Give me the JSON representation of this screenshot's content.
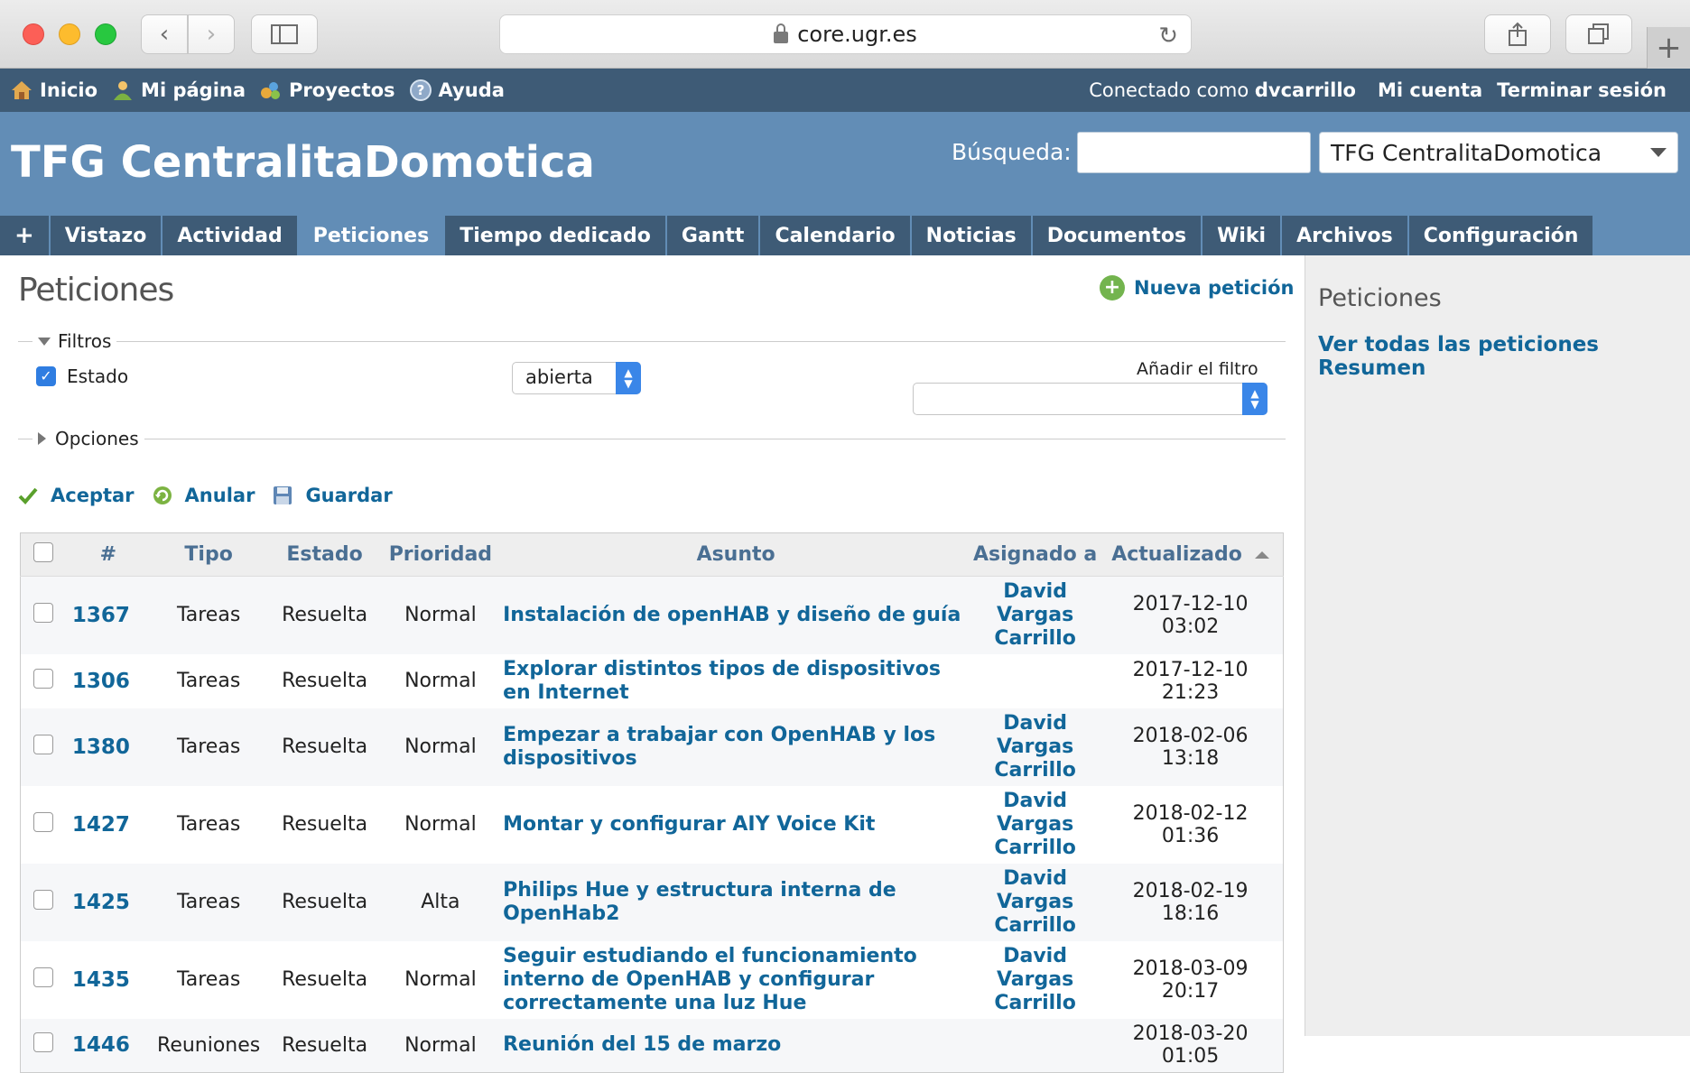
{
  "browser": {
    "url": "core.ugr.es"
  },
  "topmenu": {
    "home": "Inicio",
    "my_page": "Mi página",
    "projects": "Proyectos",
    "help": "Ayuda",
    "logged_prefix": "Conectado como",
    "username": "dvcarrillo",
    "my_account": "Mi cuenta",
    "logout": "Terminar sesión"
  },
  "header": {
    "project_title": "TFG CentralitaDomotica",
    "search_label": "Búsqueda:",
    "search_value": "",
    "project_jump": "TFG CentralitaDomotica"
  },
  "mainmenu": {
    "plus": "+",
    "tabs": [
      "Vistazo",
      "Actividad",
      "Peticiones",
      "Tiempo dedicado",
      "Gantt",
      "Calendario",
      "Noticias",
      "Documentos",
      "Wiki",
      "Archivos",
      "Configuración"
    ],
    "selected": "Peticiones"
  },
  "page": {
    "title": "Peticiones",
    "new_issue": "Nueva petición",
    "filters_legend": "Filtros",
    "filter_status_label": "Estado",
    "filter_status_value": "abierta",
    "add_filter_label": "Añadir el filtro",
    "add_filter_value": "",
    "options_legend": "Opciones",
    "apply": "Aceptar",
    "clear": "Anular",
    "save": "Guardar"
  },
  "table": {
    "columns": [
      "#",
      "Tipo",
      "Estado",
      "Prioridad",
      "Asunto",
      "Asignado a",
      "Actualizado"
    ],
    "rows": [
      {
        "id": "1367",
        "tracker": "Tareas",
        "status": "Resuelta",
        "priority": "Normal",
        "subject": "Instalación de openHAB y diseño de guía",
        "assigned": "David Vargas Carrillo",
        "updated": "2017-12-10 03:02"
      },
      {
        "id": "1306",
        "tracker": "Tareas",
        "status": "Resuelta",
        "priority": "Normal",
        "subject": "Explorar distintos tipos de dispositivos en Internet",
        "assigned": "",
        "updated": "2017-12-10 21:23"
      },
      {
        "id": "1380",
        "tracker": "Tareas",
        "status": "Resuelta",
        "priority": "Normal",
        "subject": "Empezar a trabajar con OpenHAB y los dispositivos",
        "assigned": "David Vargas Carrillo",
        "updated": "2018-02-06 13:18"
      },
      {
        "id": "1427",
        "tracker": "Tareas",
        "status": "Resuelta",
        "priority": "Normal",
        "subject": "Montar y configurar AIY Voice Kit",
        "assigned": "David Vargas Carrillo",
        "updated": "2018-02-12 01:36"
      },
      {
        "id": "1425",
        "tracker": "Tareas",
        "status": "Resuelta",
        "priority": "Alta",
        "subject": "Philips Hue y estructura interna de OpenHab2",
        "assigned": "David Vargas Carrillo",
        "updated": "2018-02-19 18:16"
      },
      {
        "id": "1435",
        "tracker": "Tareas",
        "status": "Resuelta",
        "priority": "Normal",
        "subject": "Seguir estudiando el funcionamiento interno de OpenHAB y configurar correctamente una luz Hue",
        "assigned": "David Vargas Carrillo",
        "updated": "2018-03-09 20:17"
      },
      {
        "id": "1446",
        "tracker": "Reuniones",
        "status": "Resuelta",
        "priority": "Normal",
        "subject": "Reunión del 15 de marzo",
        "assigned": "",
        "updated": "2018-03-20 01:05"
      }
    ]
  },
  "sidebar": {
    "title": "Peticiones",
    "view_all": "Ver todas las peticiones",
    "summary": "Resumen"
  }
}
